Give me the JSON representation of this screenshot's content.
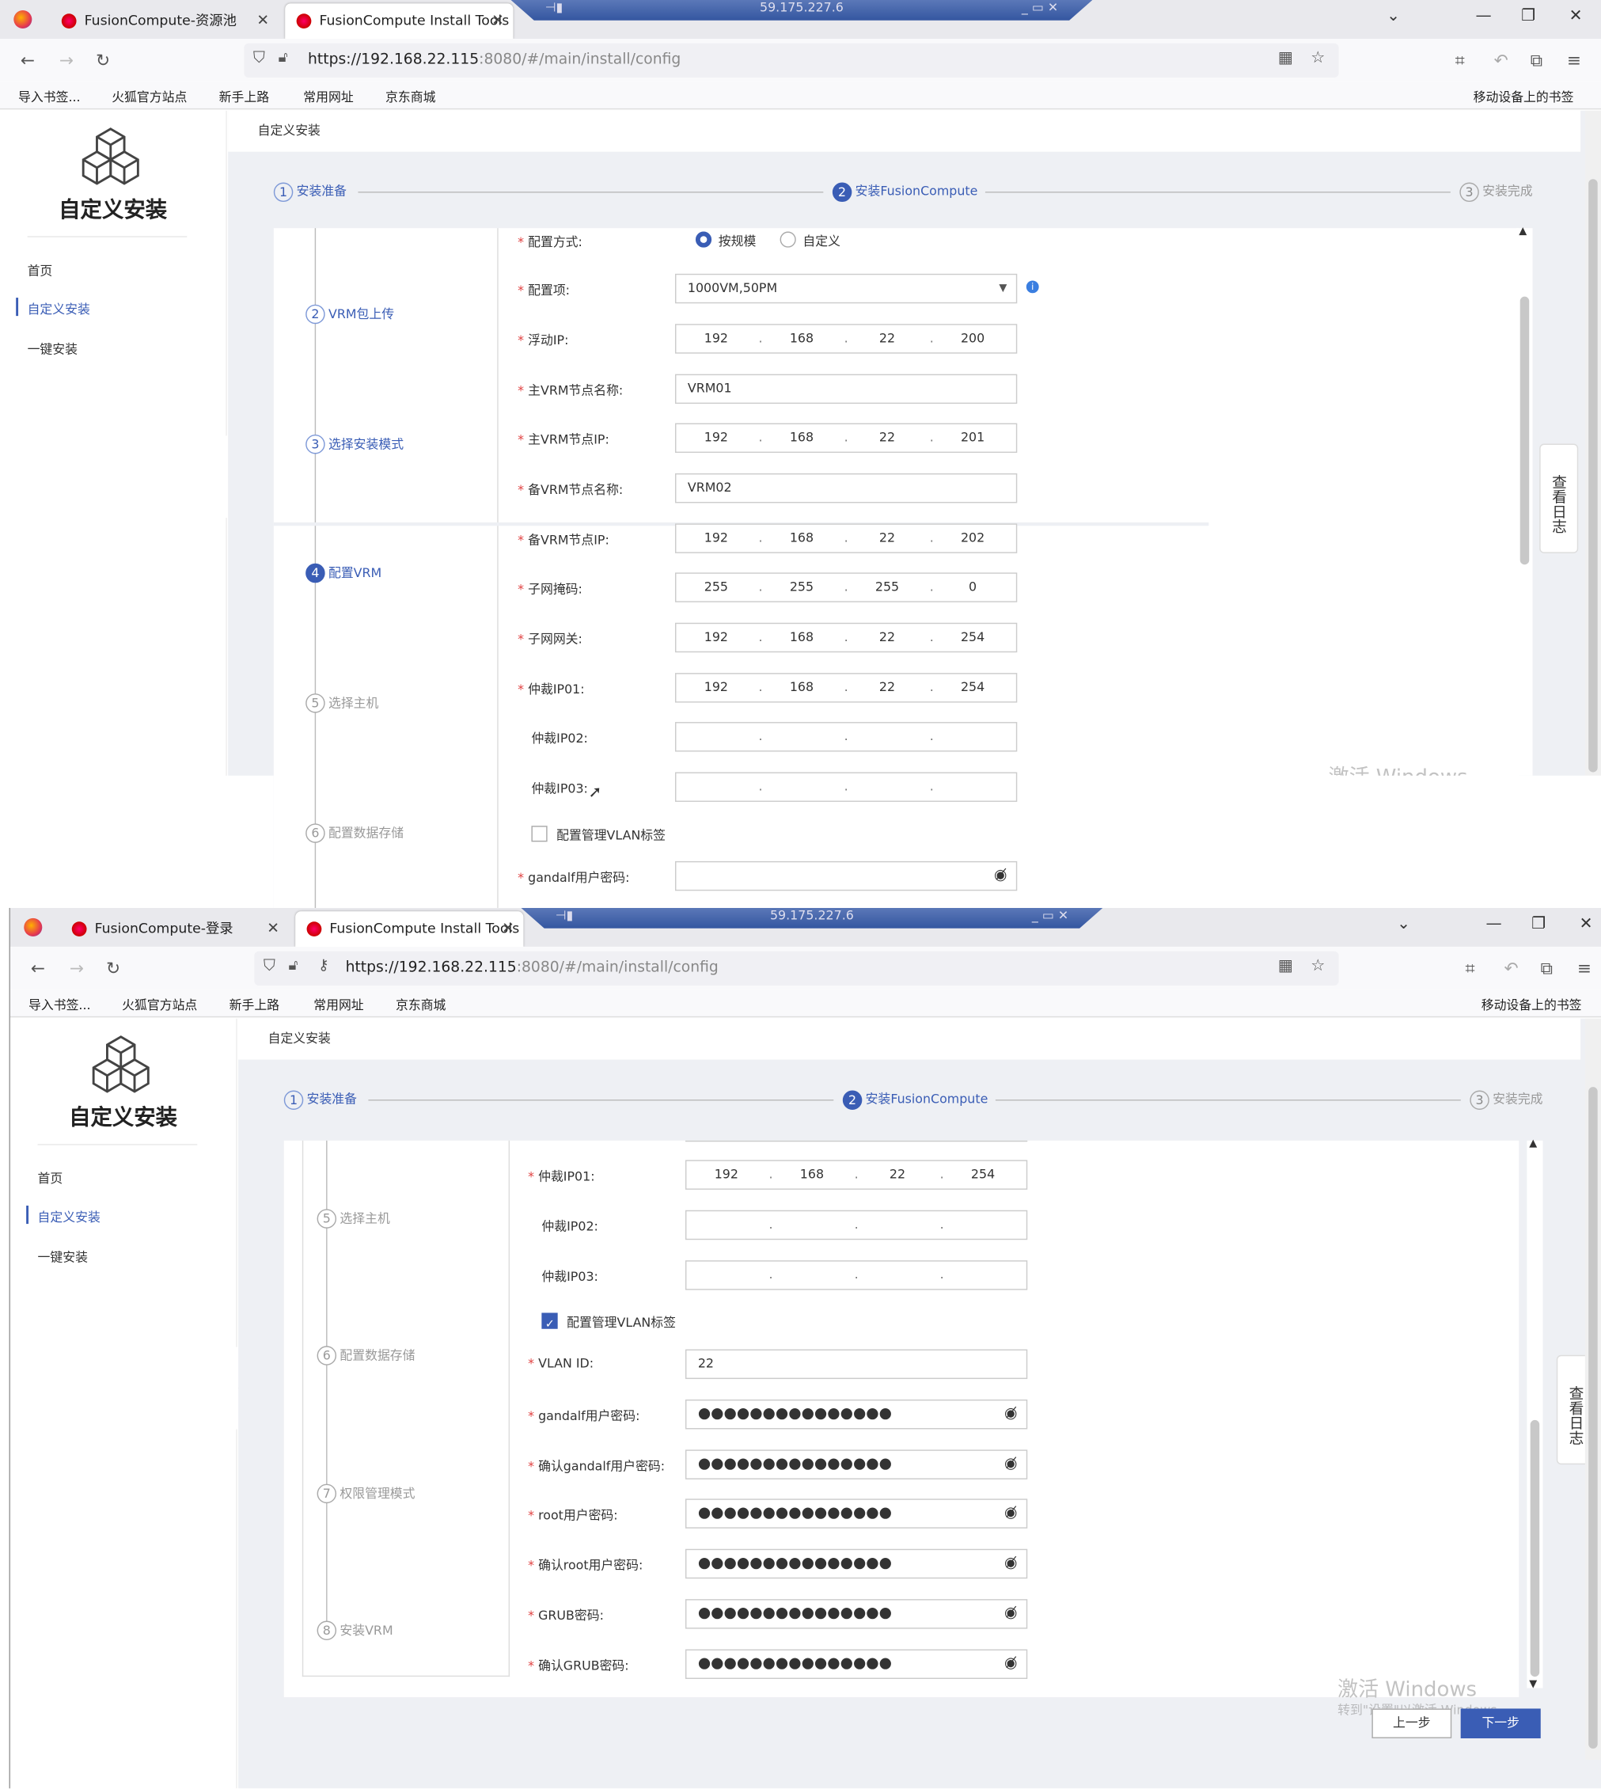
{
  "shots": [
    {
      "tabs": [
        {
          "label": "FusionCompute-资源池"
        },
        {
          "label": "FusionCompute Install Tools"
        }
      ],
      "remote_ip": "59.175.227.6",
      "url_host": "https://192.168.22.115",
      "url_rest": ":8080/#/main/install/config",
      "bookmarks": [
        "导入书签...",
        "火狐官方站点",
        "新手上路",
        "常用网址",
        "京东商城"
      ],
      "mobile_bookmarks": "移动设备上的书签",
      "fields": {
        "config_mode": "配置方式:",
        "mode_scale": "按规模",
        "mode_custom": "自定义",
        "config_item": "配置项:",
        "config_item_value": "1000VM,50PM",
        "float_ip": "浮动IP:",
        "float_ip_v": [
          "192",
          "168",
          "22",
          "200"
        ],
        "primary_name": "主VRM节点名称:",
        "primary_name_v": "VRM01",
        "primary_ip": "主VRM节点IP:",
        "primary_ip_v": [
          "192",
          "168",
          "22",
          "201"
        ],
        "standby_name": "备VRM节点名称:",
        "standby_name_v": "VRM02",
        "standby_ip": "备VRM节点IP:",
        "standby_ip_v": [
          "192",
          "168",
          "22",
          "202"
        ],
        "mask": "子网掩码:",
        "mask_v": [
          "255",
          "255",
          "255",
          "0"
        ],
        "gateway": "子网网关:",
        "gateway_v": [
          "192",
          "168",
          "22",
          "254"
        ],
        "arb1": "仲裁IP01:",
        "arb1_v": [
          "192",
          "168",
          "22",
          "254"
        ],
        "arb2": "仲裁IP02:",
        "arb3": "仲裁IP03:",
        "vlan_cb": "配置管理VLAN标签",
        "gandalf_pwd": "gandalf用户密码:"
      },
      "vsteps": [
        {
          "n": "2",
          "label": "VRM包上传"
        },
        {
          "n": "3",
          "label": "选择安装模式"
        },
        {
          "n": "4",
          "label": "配置VRM"
        },
        {
          "n": "5",
          "label": "选择主机"
        },
        {
          "n": "6",
          "label": "配置数据存储"
        }
      ],
      "watermark": "激活 Windows"
    },
    {
      "tabs": [
        {
          "label": "FusionCompute-登录"
        },
        {
          "label": "FusionCompute Install Tools"
        }
      ],
      "remote_ip": "59.175.227.6",
      "url_host": "https://192.168.22.115",
      "url_rest": ":8080/#/main/install/config",
      "bookmarks": [
        "导入书签...",
        "火狐官方站点",
        "新手上路",
        "常用网址",
        "京东商城"
      ],
      "mobile_bookmarks": "移动设备上的书签",
      "fields": {
        "arb1": "仲裁IP01:",
        "arb1_v": [
          "192",
          "168",
          "22",
          "254"
        ],
        "arb2": "仲裁IP02:",
        "arb3": "仲裁IP03:",
        "vlan_cb": "配置管理VLAN标签",
        "vlan_id": "VLAN ID:",
        "vlan_id_v": "22",
        "gandalf_pwd": "gandalf用户密码:",
        "gandalf_pwd2": "确认gandalf用户密码:",
        "root_pwd": "root用户密码:",
        "root_pwd2": "确认root用户密码:",
        "grub_pwd": "GRUB密码:",
        "grub_pwd2": "确认GRUB密码:",
        "pwd_mask": "●●●●●●●●●●●●●●●"
      },
      "vsteps": [
        {
          "n": "5",
          "label": "选择主机"
        },
        {
          "n": "6",
          "label": "配置数据存储"
        },
        {
          "n": "7",
          "label": "权限管理模式"
        },
        {
          "n": "8",
          "label": "安装VRM"
        }
      ],
      "watermark": "激活 Windows",
      "watermark_sub": "转到\"设置\"以激活 Windows。",
      "prev_btn": "上一步",
      "next_btn": "下一步"
    }
  ],
  "app": {
    "title": "自定义安装",
    "menu": [
      "首页",
      "自定义安装",
      "一键安装"
    ],
    "breadcrumb": "自定义安装",
    "steps": [
      {
        "n": "1",
        "label": "安装准备"
      },
      {
        "n": "2",
        "label": "安装FusionCompute"
      },
      {
        "n": "3",
        "label": "安装完成"
      }
    ],
    "log_btn": "查看日志"
  }
}
